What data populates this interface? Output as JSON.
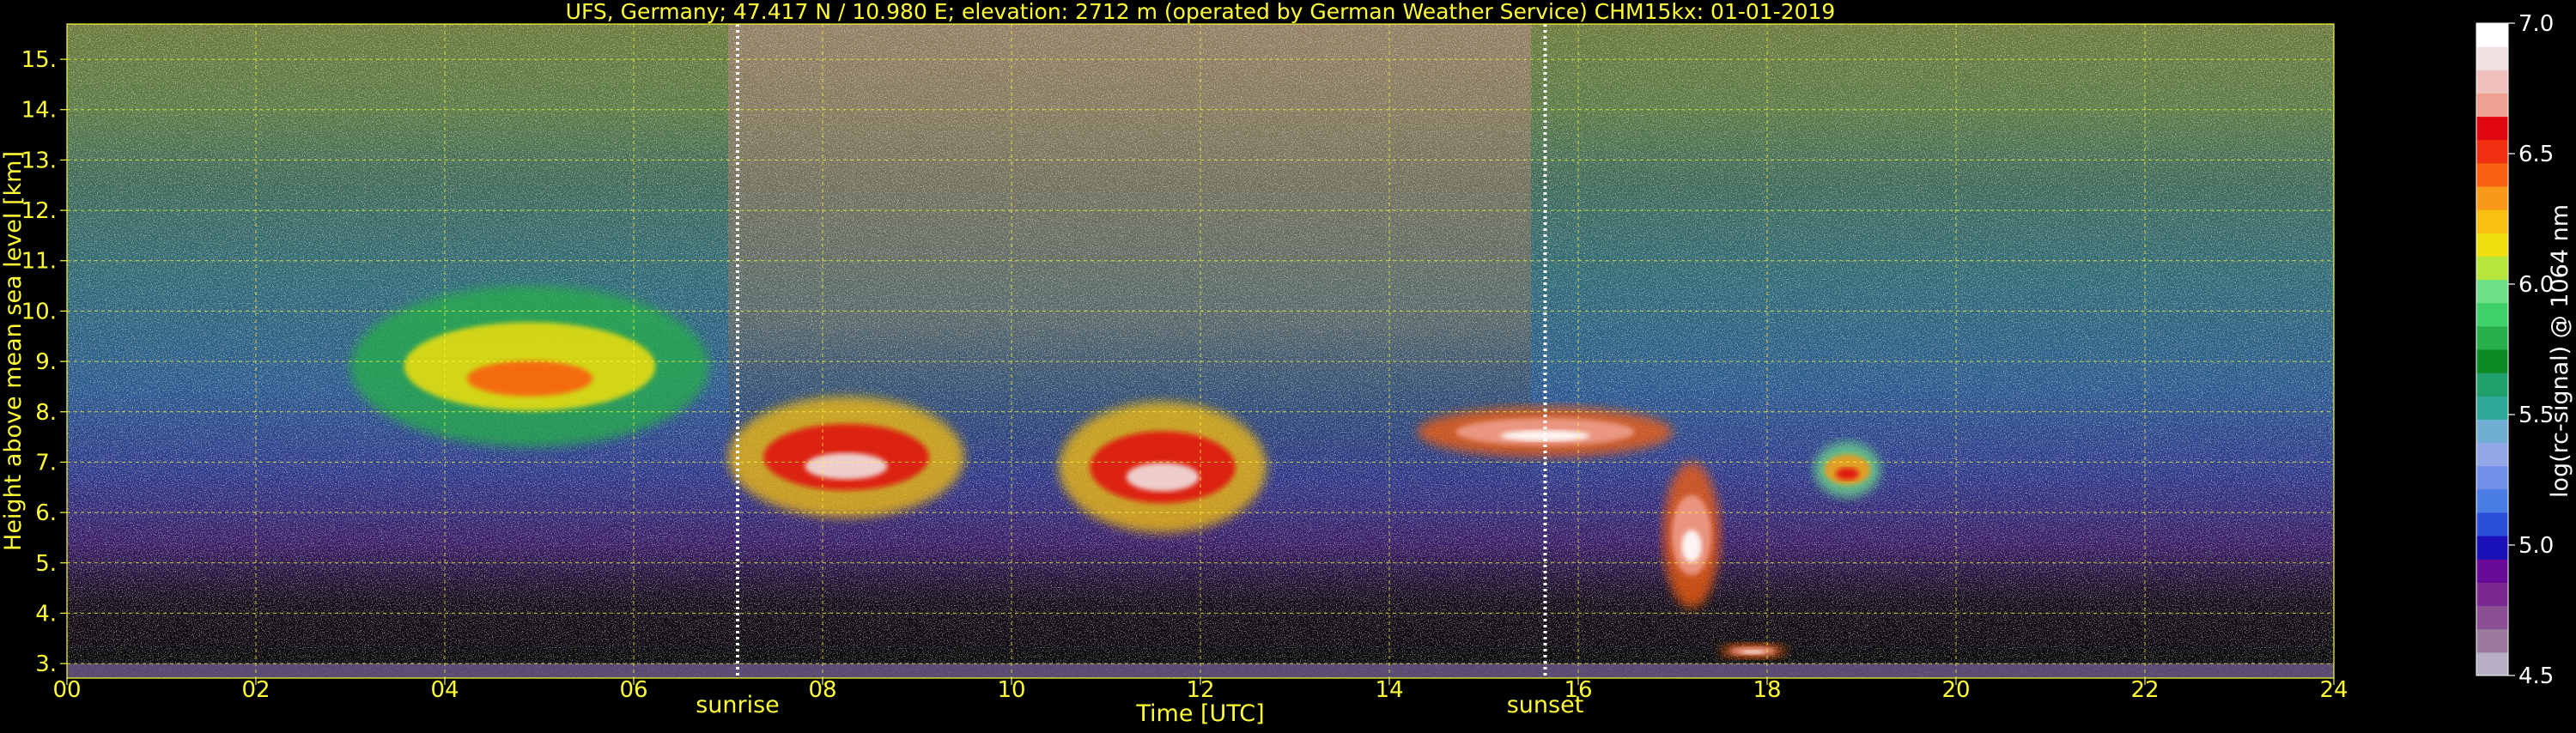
{
  "chart_data": {
    "type": "heatmap",
    "title": "UFS, Germany; 47.417 N / 10.980 E; elevation: 2712 m  (operated by German Weather Service)    CHM15kx: 01-01-2019",
    "xlabel": "Time [UTC]",
    "ylabel": "Height above mean sea level [km]",
    "xlim": [
      0,
      24
    ],
    "ylim": [
      2.712,
      15.7
    ],
    "x_ticks": [
      0,
      2,
      4,
      6,
      8,
      10,
      12,
      14,
      16,
      18,
      20,
      22,
      24
    ],
    "x_tick_labels": [
      "00",
      "02",
      "04",
      "06",
      "08",
      "10",
      "12",
      "14",
      "16",
      "18",
      "20",
      "22",
      "24"
    ],
    "y_ticks": [
      3,
      4,
      5,
      6,
      7,
      8,
      9,
      10,
      11,
      12,
      13,
      14,
      15
    ],
    "y_tick_labels": [
      "3.",
      "4.",
      "5.",
      "6.",
      "7.",
      "8.",
      "9.",
      "10.",
      "11.",
      "12.",
      "13.",
      "14.",
      "15."
    ],
    "grid": true,
    "markers": [
      {
        "label": "sunrise",
        "time": 7.1
      },
      {
        "label": "sunset",
        "time": 15.65
      }
    ],
    "colorbar": {
      "label": "log(rc-signal) @ 1064 nm",
      "range": [
        4.5,
        7.0
      ],
      "tick_values": [
        4.5,
        5.0,
        5.5,
        6.0,
        6.5,
        7.0
      ],
      "tick_labels": [
        "4.5",
        "5.0",
        "5.5",
        "6.0",
        "6.5",
        "7.0"
      ],
      "colors": [
        "#b7b0c4",
        "#9c7a9f",
        "#8b4f96",
        "#7a2a8e",
        "#6a0a9a",
        "#1a10b8",
        "#2a50d8",
        "#4a7ee6",
        "#6f8fe8",
        "#93a6e6",
        "#6faed0",
        "#2fa89a",
        "#1f9f6a",
        "#0a8a22",
        "#27b04a",
        "#3fd06a",
        "#6ee08a",
        "#b6e63a",
        "#f0e010",
        "#f8c010",
        "#f89a18",
        "#f86010",
        "#f03010",
        "#e00810",
        "#f0a090",
        "#f0c0bc",
        "#f0e0e0",
        "#ffffff"
      ]
    },
    "background_profile": [
      {
        "height": 2.8,
        "color": "#050505"
      },
      {
        "height": 4.2,
        "color": "#140c18"
      },
      {
        "height": 5.4,
        "color": "#3a1f66"
      },
      {
        "height": 6.8,
        "color": "#2f3a8a"
      },
      {
        "height": 8.5,
        "color": "#2b5a8e"
      },
      {
        "height": 10.5,
        "color": "#2f6a78"
      },
      {
        "height": 12.5,
        "color": "#3f6a5a"
      },
      {
        "height": 14.0,
        "color": "#5a7a46"
      },
      {
        "height": 15.7,
        "color": "#6a7a3a"
      }
    ],
    "noise_region": {
      "x": [
        7.0,
        15.5
      ],
      "y": [
        6.5,
        15.7
      ],
      "color": "#8a6a50"
    },
    "cloud_features": [
      {
        "name": "cloud-night-ice",
        "x": [
          3.0,
          6.8
        ],
        "y": [
          7.3,
          10.5
        ],
        "peak": 6.4
      },
      {
        "name": "cloud-morning-layer",
        "x": [
          7.0,
          9.5
        ],
        "y": [
          5.9,
          8.3
        ],
        "peak": 6.9
      },
      {
        "name": "cloud-midday-layer",
        "x": [
          10.5,
          12.7
        ],
        "y": [
          5.6,
          8.2
        ],
        "peak": 6.9
      },
      {
        "name": "cloud-evening-layer",
        "x": [
          14.3,
          17.0
        ],
        "y": [
          7.1,
          8.1
        ],
        "peak": 7.0
      },
      {
        "name": "cloud-fallstreak",
        "x": [
          16.9,
          17.5
        ],
        "y": [
          4.1,
          7.0
        ],
        "peak": 7.0
      },
      {
        "name": "cloud-patch-1830",
        "x": [
          18.5,
          19.2
        ],
        "y": [
          6.3,
          7.4
        ],
        "peak": 6.6
      },
      {
        "name": "low-cloud-1700",
        "x": [
          17.5,
          18.2
        ],
        "y": [
          3.1,
          3.4
        ],
        "peak": 7.0
      }
    ]
  }
}
